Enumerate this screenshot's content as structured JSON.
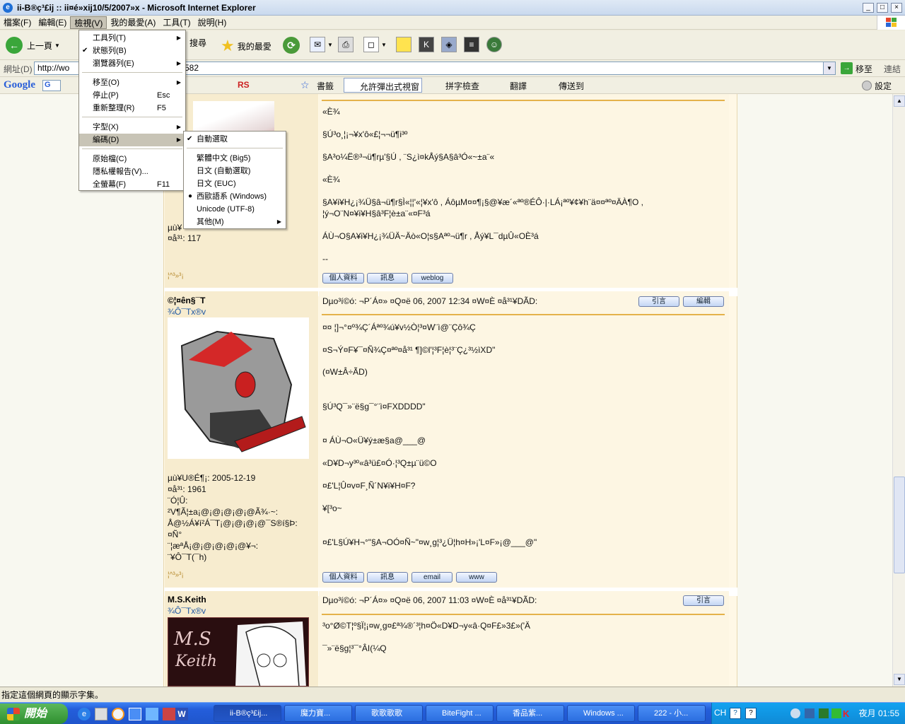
{
  "window": {
    "title": "ii-B®ç³£ij :: ii¤é»xij10/5/2007»x - Microsoft Internet Explorer"
  },
  "menubar": [
    "檔案(F)",
    "編輯(E)",
    "檢視(V)",
    "我的最愛(A)",
    "工具(T)",
    "說明(H)"
  ],
  "toolbar": {
    "back": "上一頁",
    "search": "搜尋",
    "favorites": "我的最愛"
  },
  "address": {
    "label": "網址(D)",
    "value": "http://wo",
    "suffix": "582",
    "go": "移至",
    "links": "連結"
  },
  "googlebar": {
    "logo": "Google",
    "g": "G",
    "bookmarks": "書籤",
    "popup": "允許彈出式視窗",
    "spell": "拼字檢查",
    "translate": "翻譯",
    "sendto": "傳送到",
    "settings": "設定",
    "rs": "RS"
  },
  "view_menu": {
    "items": [
      {
        "label": "工具列(T)",
        "sub": true
      },
      {
        "label": "狀態列(B)",
        "check": true
      },
      {
        "label": "瀏覽器列(E)",
        "sub": true
      },
      {
        "label": "移至(O)",
        "sub": true
      },
      {
        "label": "停止(P)",
        "shortcut": "Esc"
      },
      {
        "label": "重新整理(R)",
        "shortcut": "F5"
      },
      {
        "label": "字型(X)",
        "sub": true
      },
      {
        "label": "編碼(D)",
        "sub": true
      },
      {
        "label": "原始檔(C)"
      },
      {
        "label": "隱私權報告(V)..."
      },
      {
        "label": "全螢幕(F)",
        "shortcut": "F11"
      }
    ]
  },
  "encoding_menu": {
    "items": [
      {
        "label": "自動選取",
        "check": true
      },
      {
        "label": "繁體中文 (Big5)"
      },
      {
        "label": "日文 (自動選取)"
      },
      {
        "label": "日文 (EUC)"
      },
      {
        "label": "西歐語系 (Windows)",
        "radio": true
      },
      {
        "label": "Unicode (UTF-8)"
      },
      {
        "label": "其他(M)",
        "sub": true
      }
    ]
  },
  "posts": [
    {
      "lines": [
        "«È¾",
        "§Ú³o¸¦¡¬¥x'ô«£¦¬¬ü¶i³º",
        "§A³o¼Ë®³¬ü¶rµ'§Ú , ¨S¿ì¤kÅý§A§â³Ó«~±a¨«",
        "«È¾",
        "§A¥i¥H¿¡¾Ü§â¬ü¶r§Ì«¦¦'«¦¥x'ô , ÁôµM¤¤¶¡§@¥æ´«ªº®ÉÔ·|·LÁ¡ªº¥¢¥h¨ä¤¤ªº¤ÄÀ¶O ,",
        "¦ý¬O¨N¤¥i¥H§â³F¦è±a¨«¤F³á",
        "ÁÙ¬O§A¥i¥H¿¡¾ÜÄ~Äò«O¦s§Aªº¬ü¶r , Åý¥L¯dµÛ«OÈ³á",
        "--"
      ],
      "footer": "¦^³»³¡",
      "stats_visible": [
        "µù¥",
        "¤å³¹: 117"
      ],
      "buttons": [
        "個人資料",
        "訊息",
        "weblog"
      ]
    },
    {
      "user": "©¦¤ên§¯T",
      "title": "¾Ô¯Tx®v",
      "meta": "Dµo³í©ó: ¬P´Á¤» ¤Q¤ë 06, 2007 12:34 ¤W¤È     ¤å³¹¥DÃD:",
      "lines": [
        "¤¤ ¦]¬°¤º¾Ç´Áªº¾ú¥v½Ò¦³¤W¨ì@¨Çô¾Ç",
        "¤S¬Ý¤F¥¯¤Ñ¾Ç¤ªº¤å³¹ ¶]©l'¦³F¦è¦³¨Ç¿³½ìXD\"",
        "(¤W±Â÷ÃD)",
        "§Ú³Q¯»¨ë§g¯°¨ì¤FXDDDD\"",
        "¤ ÁÙ¬O«Ü¥ý±æ§a@___@",
        "«D¥D¬y³º«â³ü£¤Ó·¦³Q±µ¨ü©O",
        "¤£'L¦Û¤v¤F¸Ñ´N¥i¥H¤F?",
        "¥[³o~",
        "¤£'L§Ú¥H¬°\"§A¬OÓ¤Ñ~\"¤w¸g¦³¿Ü¦h¤H»¡'L¤F»¡@___@\""
      ],
      "side": [
        "µù¥U®É¶¡: 2005-12-19",
        "¤å³¹: 1961",
        "¨Ó¦Û:",
        "²V¶Ã¦±a¡@¡@¡@¡@¡@Ã¾·~:",
        "Å@½Á¥í²Á¯T¡@¡@¡@¡@¯S®í§Þ:",
        "¤Ñ°",
        "¨¦æªÅ¡@¡@¡@¡@¡@¥¬:",
        "¨¥Ô¯T(¯h)"
      ],
      "footer": "¦^³»³¡",
      "buttons": [
        "個人資料",
        "訊息",
        "email",
        "www"
      ],
      "quote": "引言",
      "edit": "編輯"
    },
    {
      "user": "M.S.Keith",
      "title": "¾Ô¯Tx®v",
      "meta": "Dµo³í©ó: ¬P´Á¤» ¤Q¤ë 06, 2007 11:03 ¤W¤È     ¤å³¹¥DÃD:",
      "lines": [
        "³o°Ø©T¦º§Ï¦¡¤w¸g¤£ª¾®´³¦h¤Ö«D¥D¬y«â·Q¤F£»3£»('Ä",
        "¯»¨ë§g¦³¯°ÂI(¼Q"
      ],
      "quote": "引言"
    }
  ],
  "status": "指定這個網頁的顯示字集。",
  "taskbar": {
    "start": "開始",
    "tasks": [
      "ii-B®ç³£ij...",
      "魔力寶...",
      "歌歌歌歌",
      "BiteFight ...",
      "香品紫...",
      "Windows ...",
      "222 - 小..."
    ],
    "lang": "CH",
    "clock": "夜月 01:55"
  },
  "colors": {
    "accent": "#e4b24a",
    "usertitle": "#1e57a3",
    "cellbg": "#f7eccf"
  }
}
